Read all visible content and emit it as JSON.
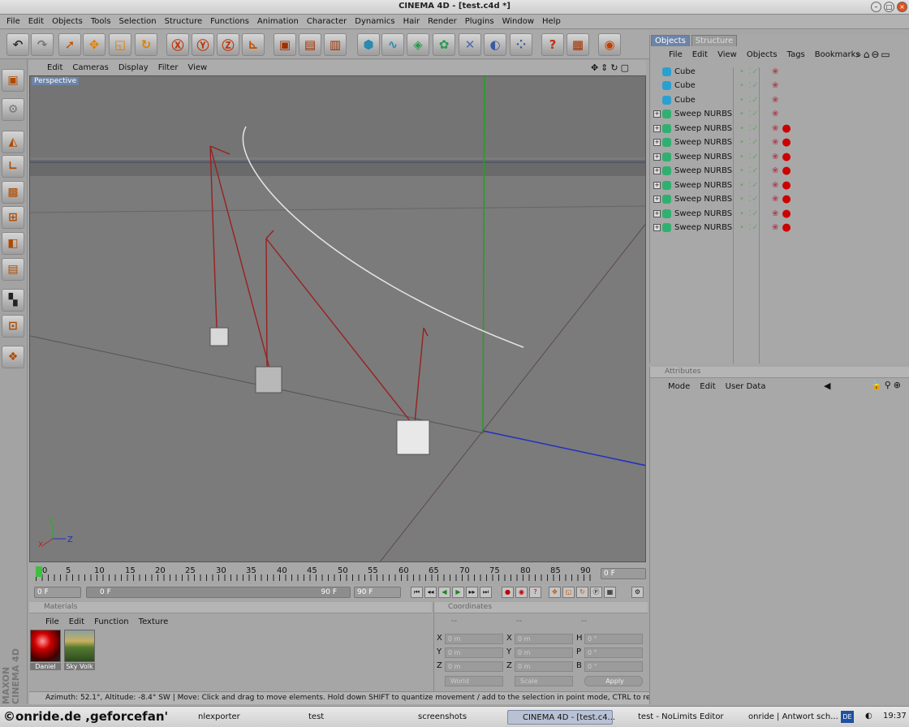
{
  "title": "CINEMA 4D - [test.c4d *]",
  "menu": [
    "File",
    "Edit",
    "Objects",
    "Tools",
    "Selection",
    "Structure",
    "Functions",
    "Animation",
    "Character",
    "Dynamics",
    "Hair",
    "Render",
    "Plugins",
    "Window",
    "Help"
  ],
  "viewport": {
    "menu": [
      "Edit",
      "Cameras",
      "Display",
      "Filter",
      "View"
    ],
    "label": "Perspective",
    "axes": {
      "y": "Y",
      "z": "Z",
      "x": "X"
    }
  },
  "timeline": {
    "ticks": [
      "0",
      "5",
      "10",
      "15",
      "20",
      "25",
      "30",
      "35",
      "40",
      "45",
      "50",
      "55",
      "60",
      "65",
      "70",
      "75",
      "80",
      "85",
      "90"
    ],
    "current": "0 F",
    "start": "0 F",
    "slider_start": "0 F",
    "slider_end": "90 F",
    "end": "90 F"
  },
  "materials": {
    "title": "Materials",
    "menu": [
      "File",
      "Edit",
      "Function",
      "Texture"
    ],
    "items": [
      {
        "name": "Daniel"
      },
      {
        "name": "Sky Volk"
      }
    ]
  },
  "coordinates": {
    "title": "Coordinates",
    "col1": "--",
    "col2": "--",
    "col3": "--",
    "rows": [
      {
        "a": "X",
        "av": "0 m",
        "b": "X",
        "bv": "0 m",
        "c": "H",
        "cv": "0 °"
      },
      {
        "a": "Y",
        "av": "0 m",
        "b": "Y",
        "bv": "0 m",
        "c": "P",
        "cv": "0 °"
      },
      {
        "a": "Z",
        "av": "0 m",
        "b": "Z",
        "bv": "0 m",
        "c": "B",
        "cv": "0 °"
      }
    ],
    "world": "World",
    "scale": "Scale",
    "apply": "Apply"
  },
  "objects": {
    "tabs": [
      "Objects",
      "Structure"
    ],
    "menu": [
      "File",
      "Edit",
      "View",
      "Objects",
      "Tags",
      "Bookmarks"
    ],
    "items": [
      {
        "name": "Cube",
        "type": "cube",
        "mat": false
      },
      {
        "name": "Cube",
        "type": "cube",
        "mat": false
      },
      {
        "name": "Cube",
        "type": "cube",
        "mat": false
      },
      {
        "name": "Sweep NURBS",
        "type": "sweep",
        "mat": false
      },
      {
        "name": "Sweep NURBS",
        "type": "sweep",
        "mat": true
      },
      {
        "name": "Sweep NURBS",
        "type": "sweep",
        "mat": true
      },
      {
        "name": "Sweep NURBS",
        "type": "sweep",
        "mat": true
      },
      {
        "name": "Sweep NURBS",
        "type": "sweep",
        "mat": true
      },
      {
        "name": "Sweep NURBS",
        "type": "sweep",
        "mat": true
      },
      {
        "name": "Sweep NURBS",
        "type": "sweep",
        "mat": true
      },
      {
        "name": "Sweep NURBS",
        "type": "sweep",
        "mat": true
      },
      {
        "name": "Sweep NURBS",
        "type": "sweep",
        "mat": true
      }
    ]
  },
  "attributes": {
    "title": "Attributes",
    "menu": [
      "Mode",
      "Edit",
      "User Data"
    ]
  },
  "status": "Azimuth: 52.1°, Altitude: -8.4°  SW  |  Move: Click and drag to move elements. Hold down SHIFT to quantize movement / add to the selection in point mode, CTRL to remove.",
  "brand": "MAXON CINEMA 4D",
  "watermark": "©onride.de ,geforcefan'",
  "taskbar": {
    "items": [
      "nlexporter",
      "test",
      "screenshots",
      "CINEMA 4D - [test.c4...",
      "test - NoLimits Editor",
      "onride | Antwort sch..."
    ],
    "lang": "DE",
    "clock": "19:37"
  }
}
